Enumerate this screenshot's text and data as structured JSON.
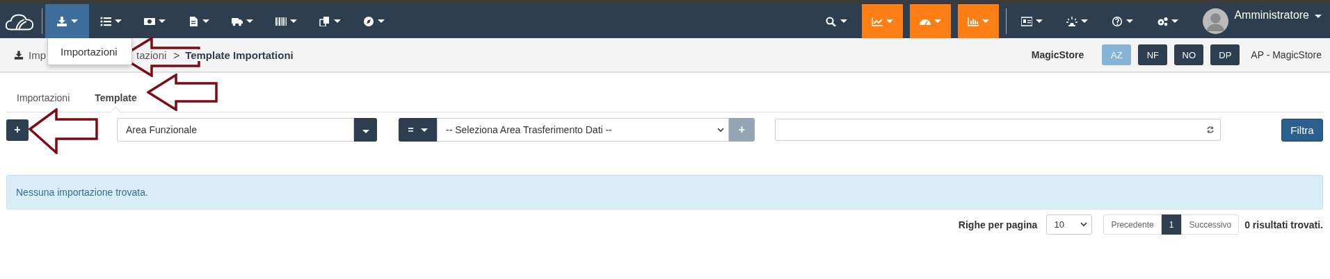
{
  "navbar": {
    "left_items": [
      {
        "selected": true
      },
      {
        "selected": false
      },
      {
        "selected": false
      },
      {
        "selected": false
      },
      {
        "selected": false
      },
      {
        "selected": false
      },
      {
        "selected": false
      },
      {
        "selected": false
      }
    ],
    "right_items": [
      {
        "accent": false
      },
      {
        "accent": true
      },
      {
        "accent": true
      },
      {
        "accent": true
      },
      {
        "accent": false
      },
      {
        "accent": false
      },
      {
        "accent": false
      },
      {
        "accent": false
      }
    ],
    "user": "Amministratore"
  },
  "dropdown_menu": {
    "items": [
      "Importazioni"
    ]
  },
  "breadcrumb": {
    "parts": [
      "Imp",
      "tazioni"
    ],
    "separator": ">",
    "current": "Template Importationi"
  },
  "store": {
    "name": "MagicStore",
    "buttons": [
      {
        "label": "AZ",
        "selected": true
      },
      {
        "label": "NF",
        "selected": false
      },
      {
        "label": "NO",
        "selected": false
      },
      {
        "label": "DP",
        "selected": false
      }
    ],
    "store_code": "AP - MagicStore"
  },
  "tabs": [
    {
      "label": "Importazioni",
      "selected": false
    },
    {
      "label": "Template",
      "selected": true
    }
  ],
  "filters": {
    "add_button": "+",
    "area_field": {
      "value": "Area Funzionale"
    },
    "operator": "=",
    "transfer_select": {
      "value": "-- Seleziona Area Trasferimento Dati --"
    },
    "add_transfer": "+",
    "filter_button": "Filtra"
  },
  "alert": "Nessuna importazione trovata.",
  "pagination": {
    "rows_label": "Righe per pagina",
    "rows_value": "10",
    "previous": "Precedente",
    "pages": [
      {
        "label": "1",
        "selected": true
      }
    ],
    "next": "Successivo",
    "results": "0 risultati trovati."
  }
}
